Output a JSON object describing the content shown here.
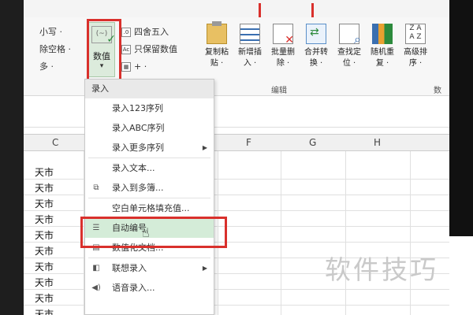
{
  "ribbon": {
    "cut_items": [
      "小写 ·",
      "除空格 ·",
      "多 ·"
    ],
    "value_button": {
      "label": "数值",
      "arrow": "▾",
      "icon": "number-format-icon"
    },
    "round_items": [
      "四舍五入",
      "只保留数值",
      "+ ·"
    ],
    "tools": [
      {
        "name": "copy-paste",
        "label1": "复制粘",
        "label2": "贴 ·",
        "icon": "clipboard-icon"
      },
      {
        "name": "add-insert",
        "label1": "新增插",
        "label2": "入 ·",
        "icon": "insert-rows-icon"
      },
      {
        "name": "batch-delete",
        "label1": "批量删",
        "label2": "除 ·",
        "icon": "delete-cells-icon"
      },
      {
        "name": "merge-convert",
        "label1": "合并转",
        "label2": "换 ·",
        "icon": "merge-icon"
      },
      {
        "name": "find-locate",
        "label1": "查找定",
        "label2": "位 ·",
        "icon": "find-icon"
      },
      {
        "name": "random-repeat",
        "label1": "随机重",
        "label2": "复 ·",
        "icon": "shuffle-icon"
      },
      {
        "name": "advanced-sort",
        "label1": "高级排",
        "label2": "序 ·",
        "icon": "sort-icon"
      }
    ],
    "sort_icon_text": "Z A\nA Z",
    "group_edit": "编辑",
    "group_data": "数"
  },
  "columns": [
    "C",
    "F",
    "G",
    "H"
  ],
  "cells": [
    "天市",
    "天市",
    "天市",
    "天市",
    "天市",
    "天市",
    "天市",
    "天市",
    "天市",
    "天市"
  ],
  "menu": {
    "title": "录入",
    "items": [
      {
        "label": "录入123序列",
        "icon": "",
        "submenu": false
      },
      {
        "label": "录入ABC序列",
        "icon": "",
        "submenu": false
      },
      {
        "label": "录入更多序列",
        "icon": "",
        "submenu": true
      },
      {
        "label": "录入文本...",
        "icon": "",
        "submenu": false
      },
      {
        "label": "录入到多簿...",
        "icon": "copy-icon",
        "submenu": false
      },
      {
        "label": "空白单元格填充值...",
        "icon": "",
        "submenu": false
      },
      {
        "label": "自动编号",
        "icon": "list-numbering-icon",
        "submenu": false,
        "highlighted": true
      },
      {
        "label": "数值化文档...",
        "icon": "document-icon",
        "submenu": false
      },
      {
        "label": "联想录入",
        "icon": "autocomplete-icon",
        "submenu": true
      },
      {
        "label": "语音录入...",
        "icon": "speaker-icon",
        "submenu": false
      }
    ]
  },
  "watermark": "软件技巧"
}
